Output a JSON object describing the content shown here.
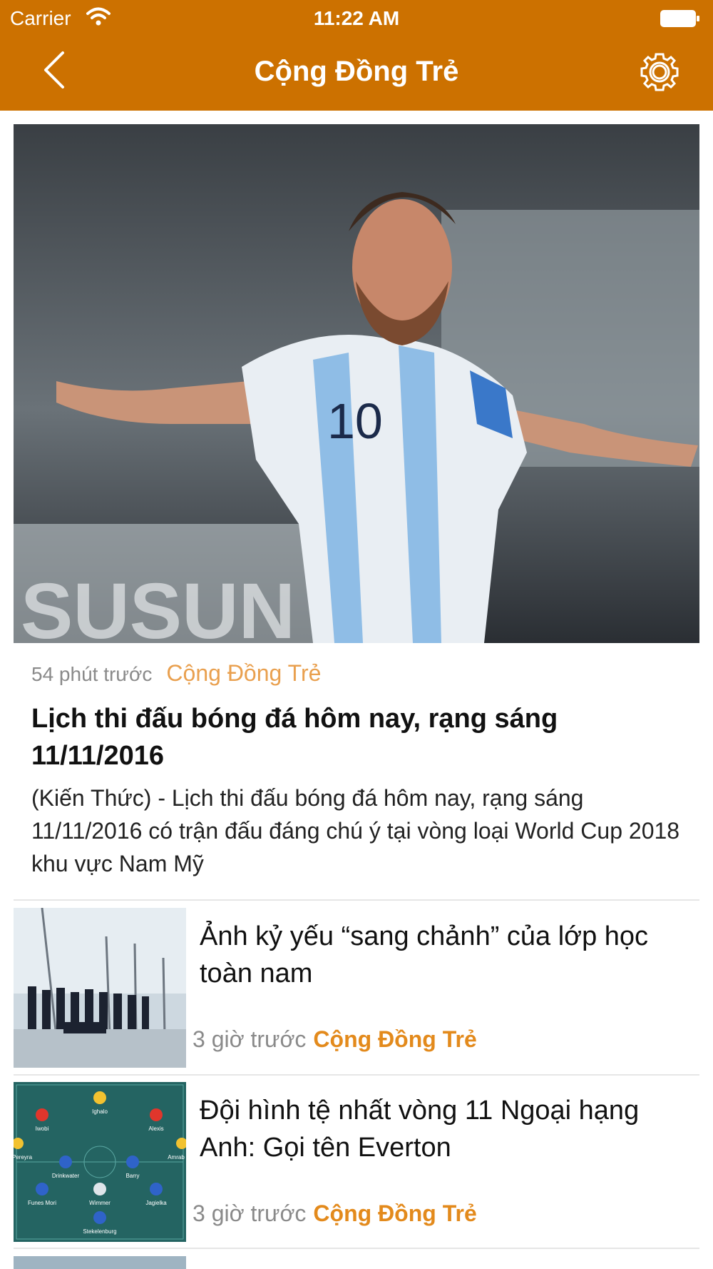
{
  "status_bar": {
    "carrier": "Carrier",
    "time": "11:22 AM"
  },
  "nav": {
    "title": "Cộng Đồng Trẻ",
    "back_icon": "chevron-left-icon",
    "settings_icon": "gear-icon"
  },
  "colors": {
    "header_bg": "#cc7100",
    "source_accent": "#e38a1c",
    "meta_gray": "#8a8a8a"
  },
  "featured": {
    "image": "photo-soccer-player-celebrating",
    "time": "54 phút trước",
    "source": "Cộng Đồng Trẻ",
    "title": "Lịch thi đấu bóng đá hôm nay, rạng sáng 11/11/2016",
    "summary": "(Kiến Thức) - Lịch thi đấu bóng đá hôm nay, rạng sáng 11/11/2016 có trận đấu đáng chú ý tại vòng loại World Cup 2018 khu vực Nam Mỹ"
  },
  "articles": [
    {
      "image": "photo-yearbook-boats",
      "title": "Ảnh kỷ yếu “sang chảnh” của lớp học toàn nam",
      "time": "3 giờ trước",
      "source": "Cộng Đồng Trẻ"
    },
    {
      "image": "graphic-football-lineup",
      "title": "Đội hình tệ nhất vòng 11 Ngoại hạng Anh: Gọi tên Everton",
      "time": "3 giờ trước",
      "source": "Cộng Đồng Trẻ",
      "lineup_labels": [
        "Ighalo",
        "Iwobi",
        "Alexis",
        "Pereyra",
        "Drinkwater",
        "Barry",
        "Funes Mori",
        "Wimmer",
        "Jagielka",
        "Stekelenburg",
        "Amrab"
      ]
    }
  ]
}
